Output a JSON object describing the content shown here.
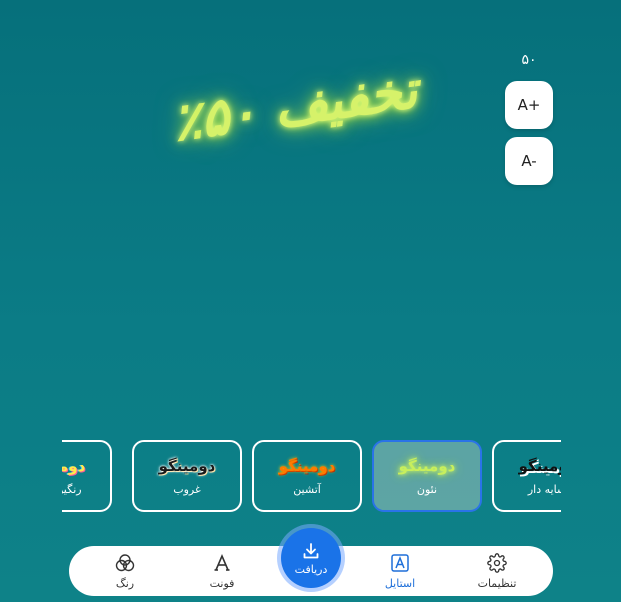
{
  "headline": {
    "text": "تخفیف ۵۰٪"
  },
  "font_size": {
    "value": "۵۰",
    "increase_label": "A+",
    "decrease_label": "A-"
  },
  "styles": [
    {
      "preview": "دومینگو",
      "label": "رنگین‌کمان",
      "variant": "colorful"
    },
    {
      "preview": "دومینگو",
      "label": "غروب",
      "variant": "sunset"
    },
    {
      "preview": "دومینگو",
      "label": "آتشین",
      "variant": "fire"
    },
    {
      "preview": "دومینگو",
      "label": "نئون",
      "variant": "neon",
      "active": true
    },
    {
      "preview": "دومینگو",
      "label": "سایه دار",
      "variant": "shadow"
    }
  ],
  "nav": {
    "color": {
      "label": "رنگ",
      "icon": "circles-icon"
    },
    "font": {
      "label": "فونت",
      "icon": "font-a-icon"
    },
    "download": {
      "label": "دریافت",
      "icon": "download-icon"
    },
    "style": {
      "label": "استایل",
      "icon": "style-a-icon"
    },
    "settings": {
      "label": "تنظیمات",
      "icon": "gear-icon"
    }
  },
  "colors": {
    "accent": "#1a73e8",
    "neon_text": "#d6f26a",
    "background_top": "#06707b",
    "background_bottom": "#0e8288"
  }
}
